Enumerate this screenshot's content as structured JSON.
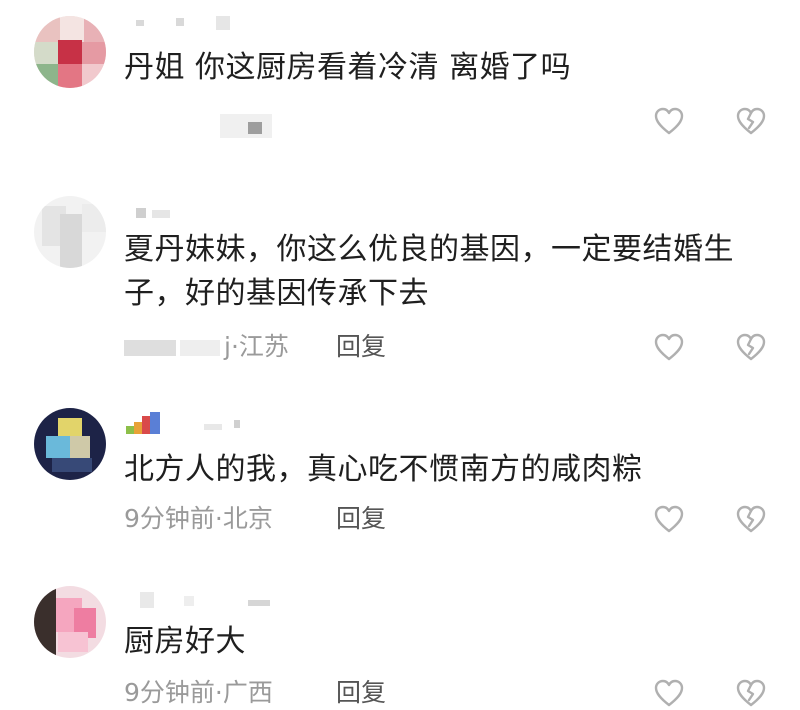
{
  "comments": [
    {
      "text": "丹姐 你这厨房看着冷清 离婚了吗",
      "meta": "",
      "reply": ""
    },
    {
      "text_line1": "夏丹妹妹，你这么优良的基因，一定要结婚生",
      "text_line2": "子，好的基因传承下去",
      "meta": "j·江苏",
      "reply": "回复"
    },
    {
      "text": "北方人的我，真心吃不惯南方的咸肉粽",
      "meta": "9分钟前·北京",
      "reply": "回复"
    },
    {
      "text": "厨房好大",
      "meta": "9分钟前·广西",
      "reply": "回复"
    }
  ],
  "icons": {
    "like": "heart-outline-icon",
    "dislike": "broken-heart-icon"
  },
  "colors": {
    "text": "#1f1f1f",
    "meta": "#9a9a9a",
    "icon": "#b0b0b0"
  }
}
